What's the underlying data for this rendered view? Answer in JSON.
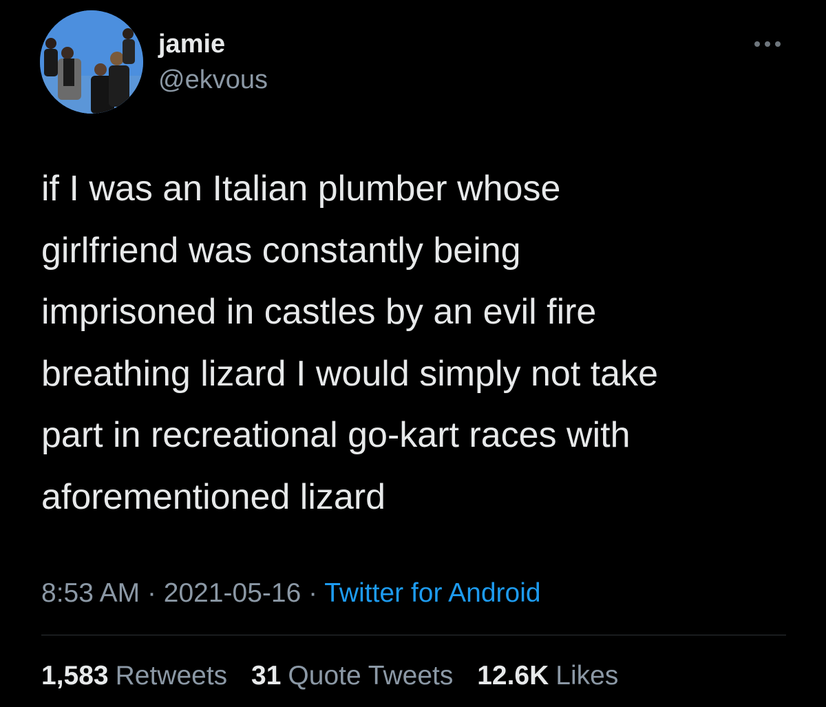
{
  "user": {
    "display_name": "jamie",
    "handle": "@ekvous"
  },
  "tweet": {
    "lines": [
      "if I was an Italian plumber whose",
      "girlfriend was constantly being",
      "imprisoned in castles by an evil fire",
      "breathing lizard I would simply not take",
      "part in recreational go-kart races with",
      "aforementioned lizard"
    ]
  },
  "meta": {
    "time": "8:53 AM",
    "separator": "·",
    "date": "2021-05-16",
    "source": "Twitter for Android"
  },
  "stats": {
    "retweets_count": "1,583",
    "retweets_label": "Retweets",
    "quotes_count": "31",
    "quotes_label": "Quote Tweets",
    "likes_count": "12.6K",
    "likes_label": "Likes"
  },
  "icons": {
    "more": "more-horizontal-icon"
  },
  "colors": {
    "background": "#000000",
    "primary_text": "#e7e9ea",
    "secondary_text": "#8b98a5",
    "link": "#1d9bf0",
    "divider": "#2f3336"
  }
}
